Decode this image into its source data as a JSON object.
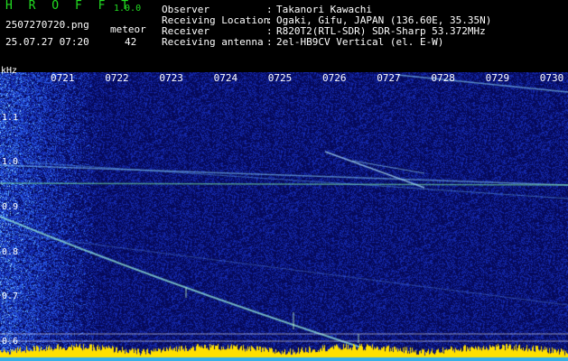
{
  "header": {
    "brand": "H R O F F T",
    "version": "1.0.0",
    "filename": "2507270720.png",
    "meteor_label": "meteor",
    "datetime": "25.07.27 07:20",
    "meteor_count": "42",
    "info": [
      {
        "label": "Observer",
        "value": "Takanori Kawachi"
      },
      {
        "label": "Receiving Location",
        "value": "Ogaki, Gifu, JAPAN (136.60E, 35.35N)"
      },
      {
        "label": "Receiver",
        "value": "R820T2(RTL-SDR) SDR-Sharp 53.372MHz"
      },
      {
        "label": "Receiving antenna",
        "value": "2el-HB9CV Vertical (el. E-W)"
      }
    ],
    "colon": ":"
  },
  "spectrogram": {
    "freq_unit": "kHz",
    "time_ticks": [
      "0721",
      "0722",
      "0723",
      "0724",
      "0725",
      "0726",
      "0727",
      "0728",
      "0729",
      "0730"
    ],
    "freq_ticks": [
      "1.1",
      "1.0",
      "0.9",
      "0.8",
      "0.7",
      "0.6"
    ],
    "colors": {
      "background": "#0a0f6e",
      "noise": "#2a48d8",
      "line": "#8ad8ff",
      "bottom": "#ffe000"
    }
  }
}
